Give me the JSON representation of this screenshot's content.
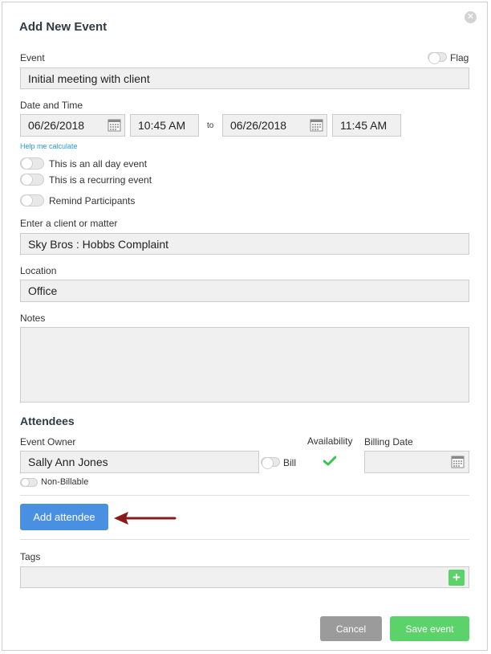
{
  "dialog": {
    "title": "Add New Event",
    "close_glyph": "✕"
  },
  "event": {
    "label": "Event",
    "value": "Initial meeting with client",
    "flag_label": "Flag"
  },
  "datetime": {
    "label": "Date and Time",
    "start_date": "06/26/2018",
    "start_time": "10:45 AM",
    "to_label": "to",
    "end_date": "06/26/2018",
    "end_time": "11:45 AM",
    "help_link": "Help me calculate"
  },
  "options": {
    "all_day": "This is an all day event",
    "recurring": "This is a recurring event",
    "remind": "Remind Participants"
  },
  "client": {
    "label": "Enter a client or matter",
    "value": "Sky Bros : Hobbs Complaint"
  },
  "location": {
    "label": "Location",
    "value": "Office"
  },
  "notes": {
    "label": "Notes",
    "value": ""
  },
  "attendees": {
    "heading": "Attendees",
    "owner_label": "Event Owner",
    "owner_value": "Sally Ann Jones",
    "bill_label": "Bill",
    "availability_label": "Availability",
    "billing_date_label": "Billing Date",
    "billing_date_value": "",
    "non_billable_label": "Non-Billable",
    "add_button": "Add attendee"
  },
  "tags": {
    "label": "Tags",
    "value": "",
    "add_glyph": "+"
  },
  "footer": {
    "cancel": "Cancel",
    "save": "Save event"
  },
  "colors": {
    "primary": "#4a90e2",
    "success": "#5cd36a",
    "cancel": "#9b9b9b",
    "link": "#2a9bd8",
    "arrow": "#8b1a1a",
    "check": "#3cc24f"
  },
  "icons": {
    "calendar": "calendar-icon",
    "check": "check-icon",
    "arrow": "arrow-icon",
    "plus": "plus-icon",
    "close": "close-icon"
  }
}
